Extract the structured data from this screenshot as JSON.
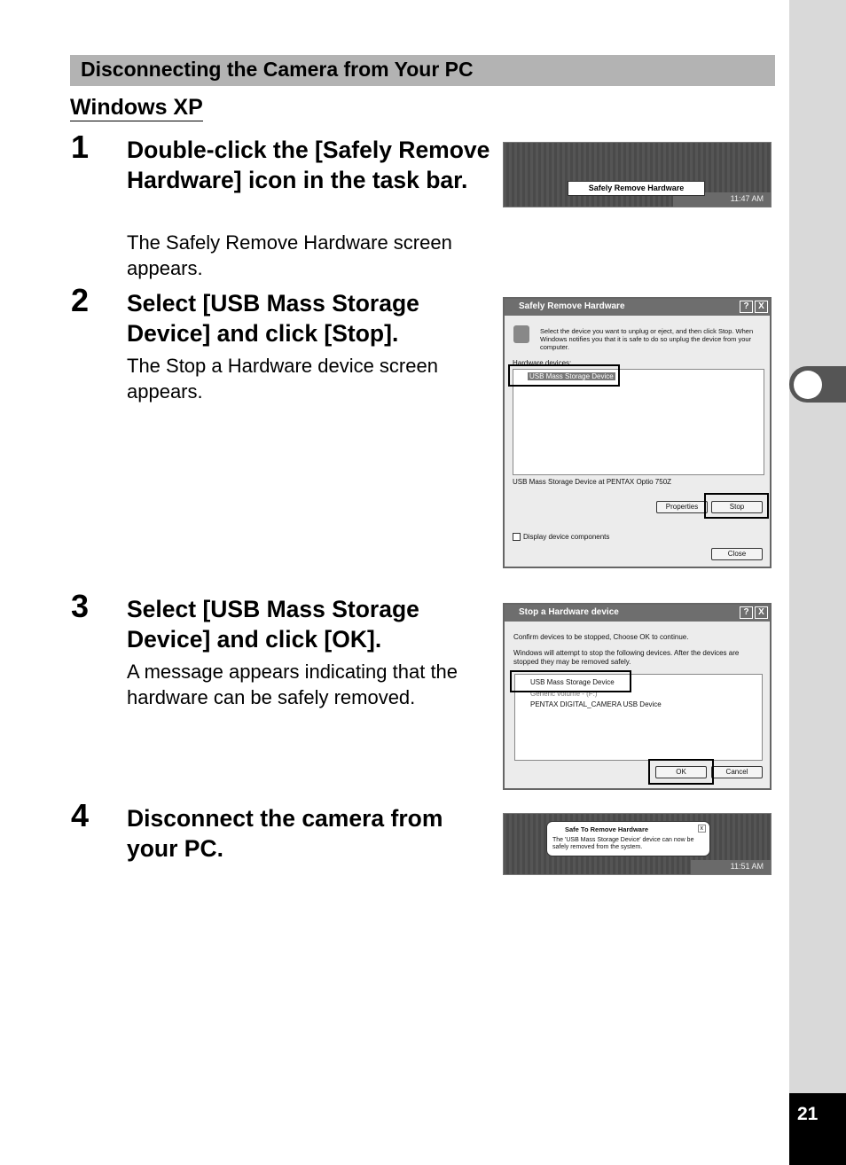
{
  "section_title": "Disconnecting the Camera from Your PC",
  "subheading": "Windows XP",
  "steps": [
    {
      "number": "1",
      "title": "Double-click the [Safely Remove Hardware] icon in the task bar.",
      "desc": "The Safely Remove Hardware screen appears."
    },
    {
      "number": "2",
      "title": "Select [USB Mass Storage Device] and click [Stop].",
      "desc": "The Stop a Hardware device screen appears."
    },
    {
      "number": "3",
      "title": "Select [USB Mass Storage Device] and click [OK].",
      "desc": "A message appears indicating that the hardware can be safely removed."
    },
    {
      "number": "4",
      "title": "Disconnect the camera from your PC.",
      "desc": ""
    }
  ],
  "shot1": {
    "tooltip": "Safely Remove Hardware",
    "time": "11:47 AM"
  },
  "shot2": {
    "title": "Safely Remove Hardware",
    "help": "?",
    "close": "X",
    "instructions": "Select the device you want to unplug or eject, and then click Stop. When Windows notifies you that it is safe to do so unplug the device from your computer.",
    "list_label": "Hardware devices:",
    "device": "USB Mass Storage Device",
    "device_info": "USB Mass Storage Device at PENTAX Optio 750Z",
    "properties": "Properties",
    "stop": "Stop",
    "checkbox": "Display device components",
    "close_btn": "Close"
  },
  "shot3": {
    "title": "Stop a Hardware device",
    "help": "?",
    "close": "X",
    "line1": "Confirm devices to be stopped, Choose OK to continue.",
    "line2": "Windows will attempt to stop the following devices. After the devices are stopped they may be removed safely.",
    "devices": [
      "USB Mass Storage Device",
      "Generic volume - (F:)",
      "PENTAX DIGITAL_CAMERA USB Device"
    ],
    "ok": "OK",
    "cancel": "Cancel"
  },
  "shot4": {
    "title": "Safe To Remove Hardware",
    "message": "The 'USB Mass Storage Device' device can now be safely removed from the system.",
    "close": "x",
    "time": "11:51 AM"
  },
  "page_number": "21"
}
